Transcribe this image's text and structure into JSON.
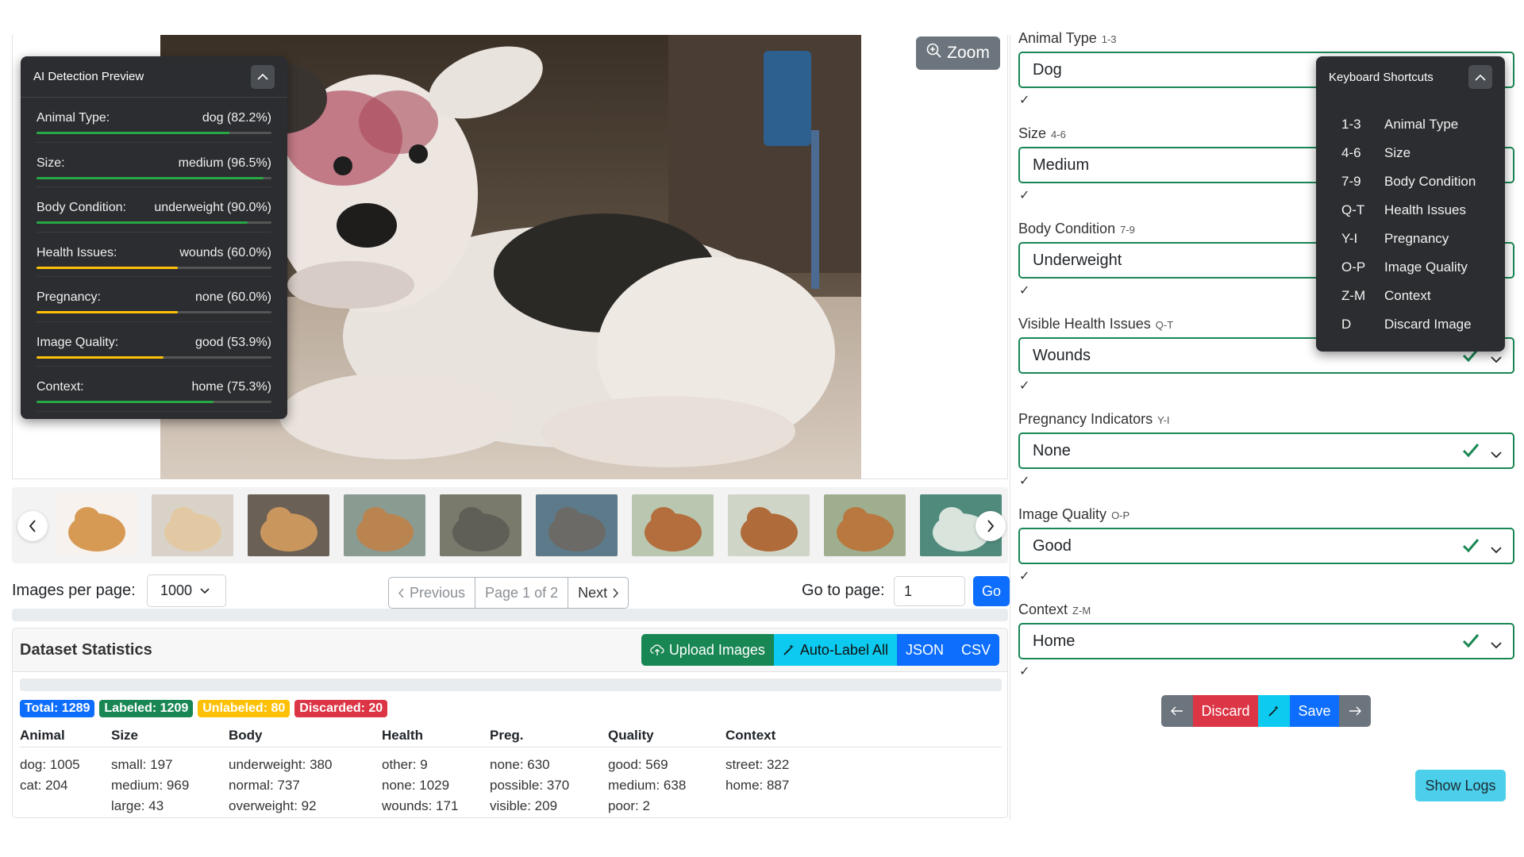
{
  "zoom_label": "Zoom",
  "ai_preview": {
    "title": "AI Detection Preview",
    "rows": [
      {
        "label": "Animal Type:",
        "value": "dog (82.2%)",
        "confidence": 82.2,
        "color": "#28a745"
      },
      {
        "label": "Size:",
        "value": "medium (96.5%)",
        "confidence": 96.5,
        "color": "#28a745"
      },
      {
        "label": "Body Condition:",
        "value": "underweight (90.0%)",
        "confidence": 90.0,
        "color": "#28a745"
      },
      {
        "label": "Health Issues:",
        "value": "wounds (60.0%)",
        "confidence": 60.0,
        "color": "#ffc107"
      },
      {
        "label": "Pregnancy:",
        "value": "none (60.0%)",
        "confidence": 60.0,
        "color": "#ffc107"
      },
      {
        "label": "Image Quality:",
        "value": "good (53.9%)",
        "confidence": 53.9,
        "color": "#ffc107"
      },
      {
        "label": "Context:",
        "value": "home (75.3%)",
        "confidence": 75.3,
        "color": "#28a745"
      }
    ]
  },
  "thumbnails": [
    "dog-lying-white-bg",
    "pug",
    "dog-on-couch",
    "dog-sitting-room",
    "cat-with-box",
    "cat-on-floor",
    "dog-portrait-garden-1",
    "dog-portrait-garden-2",
    "dog-portrait-garden-3",
    "garden-scene"
  ],
  "pagination": {
    "images_per_page_label": "Images per page:",
    "images_per_page_value": "1000",
    "previous": "Previous",
    "page_info": "Page 1 of 2",
    "next": "Next",
    "goto_label": "Go to page:",
    "goto_value": "1",
    "go": "Go"
  },
  "stats": {
    "title": "Dataset Statistics",
    "buttons": {
      "upload": "Upload Images",
      "autolabel": "Auto-Label All",
      "json": "JSON",
      "csv": "CSV"
    },
    "badges": {
      "total": "Total: 1289",
      "labeled": "Labeled: 1209",
      "unlabeled": "Unlabeled: 80",
      "discarded": "Discarded: 20"
    },
    "headers": [
      "Animal",
      "Size",
      "Body",
      "Health",
      "Preg.",
      "Quality",
      "Context"
    ],
    "columns": [
      [
        "dog: 1005",
        "cat: 204"
      ],
      [
        "small: 197",
        "medium: 969",
        "large: 43"
      ],
      [
        "underweight: 380",
        "normal: 737",
        "overweight: 92"
      ],
      [
        "other: 9",
        "none: 1029",
        "wounds: 171"
      ],
      [
        "none: 630",
        "possible: 370",
        "visible: 209"
      ],
      [
        "good: 569",
        "medium: 638",
        "poor: 2"
      ],
      [
        "street: 322",
        "home: 887"
      ]
    ]
  },
  "form": {
    "fields": [
      {
        "label": "Animal Type",
        "keys": "1-3",
        "value": "Dog"
      },
      {
        "label": "Size",
        "keys": "4-6",
        "value": "Medium"
      },
      {
        "label": "Body Condition",
        "keys": "7-9",
        "value": "Underweight"
      },
      {
        "label": "Visible Health Issues",
        "keys": "Q-T",
        "value": "Wounds"
      },
      {
        "label": "Pregnancy Indicators",
        "keys": "Y-I",
        "value": "None"
      },
      {
        "label": "Image Quality",
        "keys": "O-P",
        "value": "Good"
      },
      {
        "label": "Context",
        "keys": "Z-M",
        "value": "Home"
      }
    ],
    "valid_mark": "✓"
  },
  "shortcuts": {
    "title": "Keyboard Shortcuts",
    "items": [
      {
        "key": "1-3",
        "desc": "Animal Type"
      },
      {
        "key": "4-6",
        "desc": "Size"
      },
      {
        "key": "7-9",
        "desc": "Body Condition"
      },
      {
        "key": "Q-T",
        "desc": "Health Issues"
      },
      {
        "key": "Y-I",
        "desc": "Pregnancy"
      },
      {
        "key": "O-P",
        "desc": "Image Quality"
      },
      {
        "key": "Z-M",
        "desc": "Context"
      },
      {
        "key": "D",
        "desc": "Discard Image"
      }
    ]
  },
  "actions": {
    "discard": "Discard",
    "save": "Save"
  },
  "show_logs": "Show Logs",
  "colors": {
    "green": "#198754",
    "blue": "#0d6efd",
    "cyan": "#0dcaf0",
    "red": "#dc3545",
    "yellow": "#ffc107",
    "gray": "#6c757d"
  }
}
